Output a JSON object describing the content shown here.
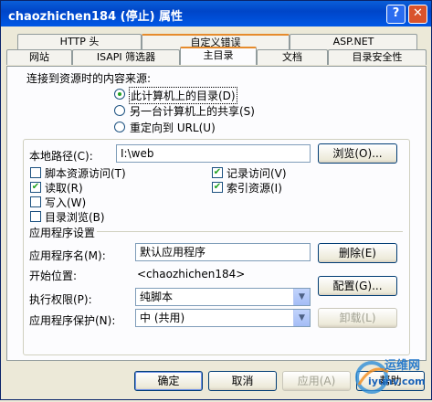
{
  "window": {
    "title": "chaozhichen184 (停止) 属性",
    "help_button": "?",
    "close_button": "✕"
  },
  "tabs_row1": [
    "HTTP 头",
    "自定义错误",
    "ASP.NET"
  ],
  "tabs_row2": [
    "网站",
    "ISAPI 筛选器",
    "主目录",
    "文档",
    "目录安全性"
  ],
  "source": {
    "heading": "连接到资源时的内容来源:",
    "options": [
      "此计算机上的目录(D)",
      "另一台计算机上的共享(S)",
      "重定向到 URL(U)"
    ],
    "selected_index": 0
  },
  "local_path": {
    "label": "本地路径(C):",
    "value": "I:\\web",
    "browse_button": "浏览(O)..."
  },
  "permissions": [
    {
      "label": "脚本资源访问(T)",
      "checked": false
    },
    {
      "label": "读取(R)",
      "checked": true
    },
    {
      "label": "写入(W)",
      "checked": false
    },
    {
      "label": "目录浏览(B)",
      "checked": false
    },
    {
      "label": "记录访问(V)",
      "checked": true
    },
    {
      "label": "索引资源(I)",
      "checked": true
    }
  ],
  "app_settings": {
    "heading": "应用程序设置",
    "app_name_label": "应用程序名(M):",
    "app_name_value": "默认应用程序",
    "remove_button": "删除(E)",
    "start_label": "开始位置:",
    "start_value": "<chaozhichen184>",
    "config_button": "配置(G)...",
    "exec_label": "执行权限(P):",
    "exec_value": "纯脚本",
    "protect_label": "应用程序保护(N):",
    "protect_value": "中 (共用)",
    "unload_button": "卸载(L)"
  },
  "footer": {
    "ok": "确定",
    "cancel": "取消",
    "apply": "应用(A)",
    "help": "帮助"
  },
  "watermark": {
    "line1": "运维网",
    "line2": "iyunv.com"
  }
}
